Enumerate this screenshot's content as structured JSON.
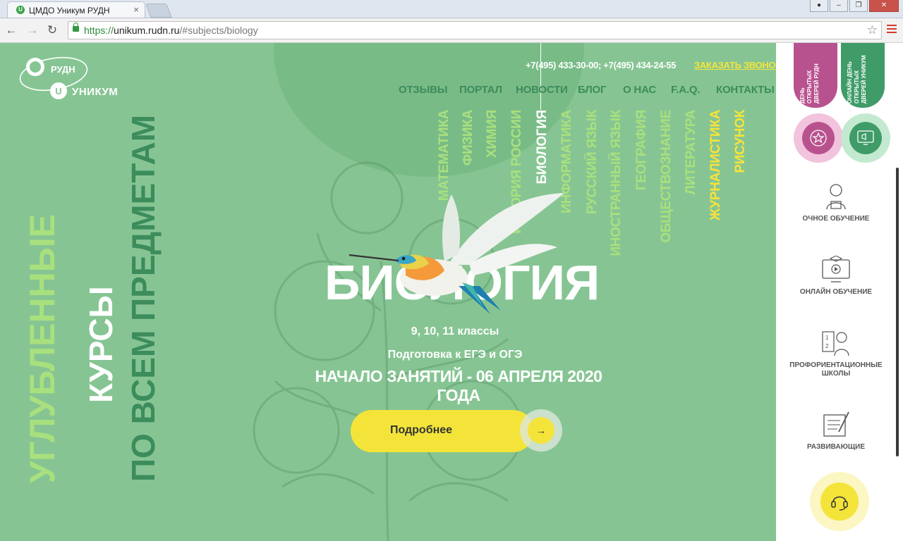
{
  "browser": {
    "tab_title": "ЦМДО Уникум РУДН",
    "tab_favicon_letter": "U",
    "tab_close": "×",
    "url_scheme": "https://",
    "url_host": "unikum.rudn.ru",
    "url_path": "/#subjects/biology"
  },
  "header": {
    "logo_rudn": "РУДН",
    "logo_unikum": "УНИКУМ",
    "phones": "+7(495) 433-30-00; +7(495) 434-24-55",
    "callback": "ЗАКАЗАТЬ ЗВОНОК",
    "nav": [
      "ОТЗЫВЫ",
      "ПОРТАЛ",
      "НОВОСТИ",
      "БЛОГ",
      "О НАС",
      "F.A.Q.",
      "КОНТАКТЫ"
    ]
  },
  "subjects": [
    {
      "label": "МАТЕМАТИКА",
      "state": "normal"
    },
    {
      "label": "ФИЗИКА",
      "state": "normal"
    },
    {
      "label": "ХИМИЯ",
      "state": "normal"
    },
    {
      "label": "ИСТОРИЯ РОССИИ",
      "state": "normal"
    },
    {
      "label": "БИОЛОГИЯ",
      "state": "active"
    },
    {
      "label": "ИНФОРМАТИКА",
      "state": "normal"
    },
    {
      "label": "РУССКИЙ ЯЗЫК",
      "state": "normal"
    },
    {
      "label": "ИНОСТРАННЫЙ ЯЗЫК",
      "state": "normal"
    },
    {
      "label": "ГЕОГРАФИЯ",
      "state": "normal"
    },
    {
      "label": "ОБЩЕСТВОЗНАНИЕ",
      "state": "normal"
    },
    {
      "label": "ЛИТЕРАТУРА",
      "state": "normal"
    },
    {
      "label": "ЖУРНАЛИСТИКА",
      "state": "highlight"
    },
    {
      "label": "РИСУНОК",
      "state": "highlight"
    }
  ],
  "subject_colors": {
    "normal": "#a9e07e",
    "active": "#ffffff",
    "highlight": "#f7e33a"
  },
  "hero": {
    "vertical_1": "УГЛУБЛЕННЫЕ",
    "vertical_2": "КУРСЫ",
    "vertical_3": "ПО ВСЕМ ПРЕДМЕТАМ",
    "title": "БИОЛОГИЯ",
    "grades": "9, 10, 11 классы",
    "prep": "Подготовка к ЕГЭ и ОГЭ",
    "start": "НАЧАЛО ЗАНЯТИЙ - 06 АПРЕЛЯ 2020 ГОДА",
    "button": "Подробнее",
    "button_arrow": "→"
  },
  "sidebar": {
    "open_day": [
      "ДЕНЬ",
      "ОТКРЫТЫХ",
      "ДВЕРЕЙ РУДН"
    ],
    "online_open_day": [
      "ОНЛАЙН ДЕНЬ",
      "ОТКРЫТЫХ",
      "ДВЕРЕЙ УНИКУМ"
    ],
    "items": [
      {
        "label": "ОЧНОЕ ОБУЧЕНИЕ",
        "icon": "student-icon"
      },
      {
        "label": "ОНЛАЙН ОБУЧЕНИЕ",
        "icon": "monitor-play-icon"
      },
      {
        "label": "ПРОФОРИЕНТАЦИОННЫЕ ШКОЛЫ",
        "icon": "teacher-board-icon"
      },
      {
        "label": "РАЗВИВАЮЩИЕ",
        "icon": "notebook-pen-icon"
      }
    ]
  },
  "colors": {
    "page_bg": "#86c593",
    "accent_yellow": "#f4e43a",
    "nav_green": "#3c8c5c",
    "pink": "#b8528f",
    "green": "#3f9c68"
  }
}
